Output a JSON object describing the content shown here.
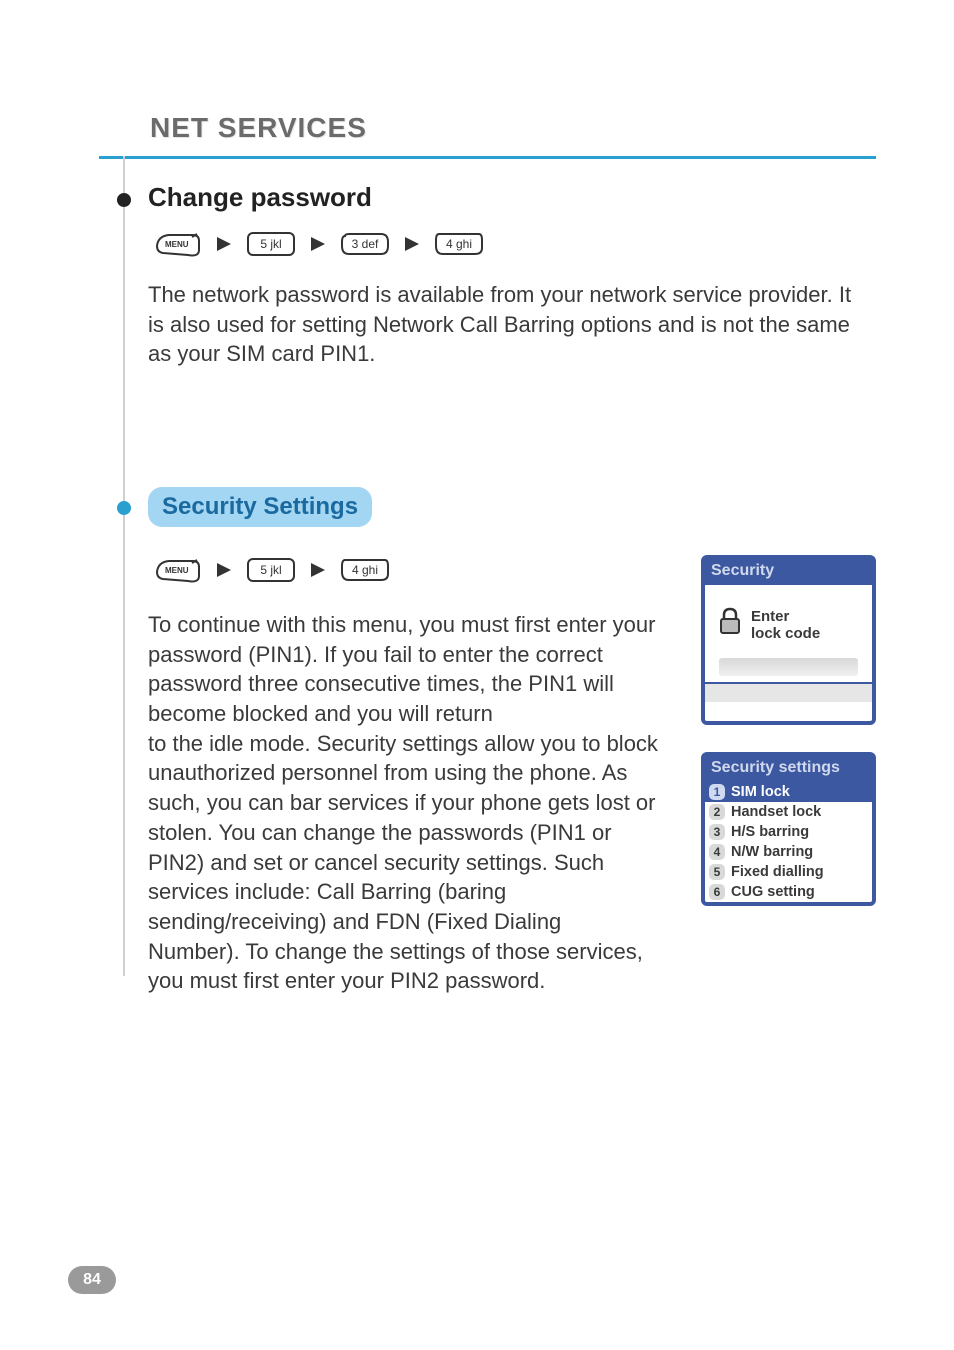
{
  "page_title": "NET SERVICES",
  "page_number": "84",
  "sections": {
    "change_password": {
      "title": "Change password",
      "keys": [
        "MENU",
        "5 jkl",
        "3 def",
        "4 ghi"
      ],
      "body": "The network password is available from your network service provider. It is also used for setting Network Call Barring options and is not the same\nas your SIM card PIN1."
    },
    "security_settings": {
      "title": "Security Settings",
      "keys": [
        "MENU",
        "5 jkl",
        "4 ghi"
      ],
      "body": "To continue with this menu, you must first enter your password (PIN1). If you fail to enter the correct password three consecutive times, the PIN1 will become blocked and you will return\nto the idle mode. Security settings allow you to block unauthorized personnel from using the phone. As such, you can bar services if your phone gets lost or stolen. You can change the passwords (PIN1 or PIN2) and set or cancel security settings. Such services include: Call Barring (baring sending/receiving) and FDN (Fixed Dialing Number). To change the settings of those services, you must first enter your PIN2 password."
    }
  },
  "phone_screens": {
    "lock": {
      "title": "Security",
      "line1": "Enter",
      "line2": "lock code"
    },
    "menu": {
      "title": "Security settings",
      "items": [
        {
          "n": "1",
          "label": "SIM lock",
          "selected": true
        },
        {
          "n": "2",
          "label": "Handset lock",
          "selected": false
        },
        {
          "n": "3",
          "label": "H/S barring",
          "selected": false
        },
        {
          "n": "4",
          "label": "N/W barring",
          "selected": false
        },
        {
          "n": "5",
          "label": "Fixed dialling",
          "selected": false
        },
        {
          "n": "6",
          "label": "CUG setting",
          "selected": false
        }
      ]
    }
  }
}
